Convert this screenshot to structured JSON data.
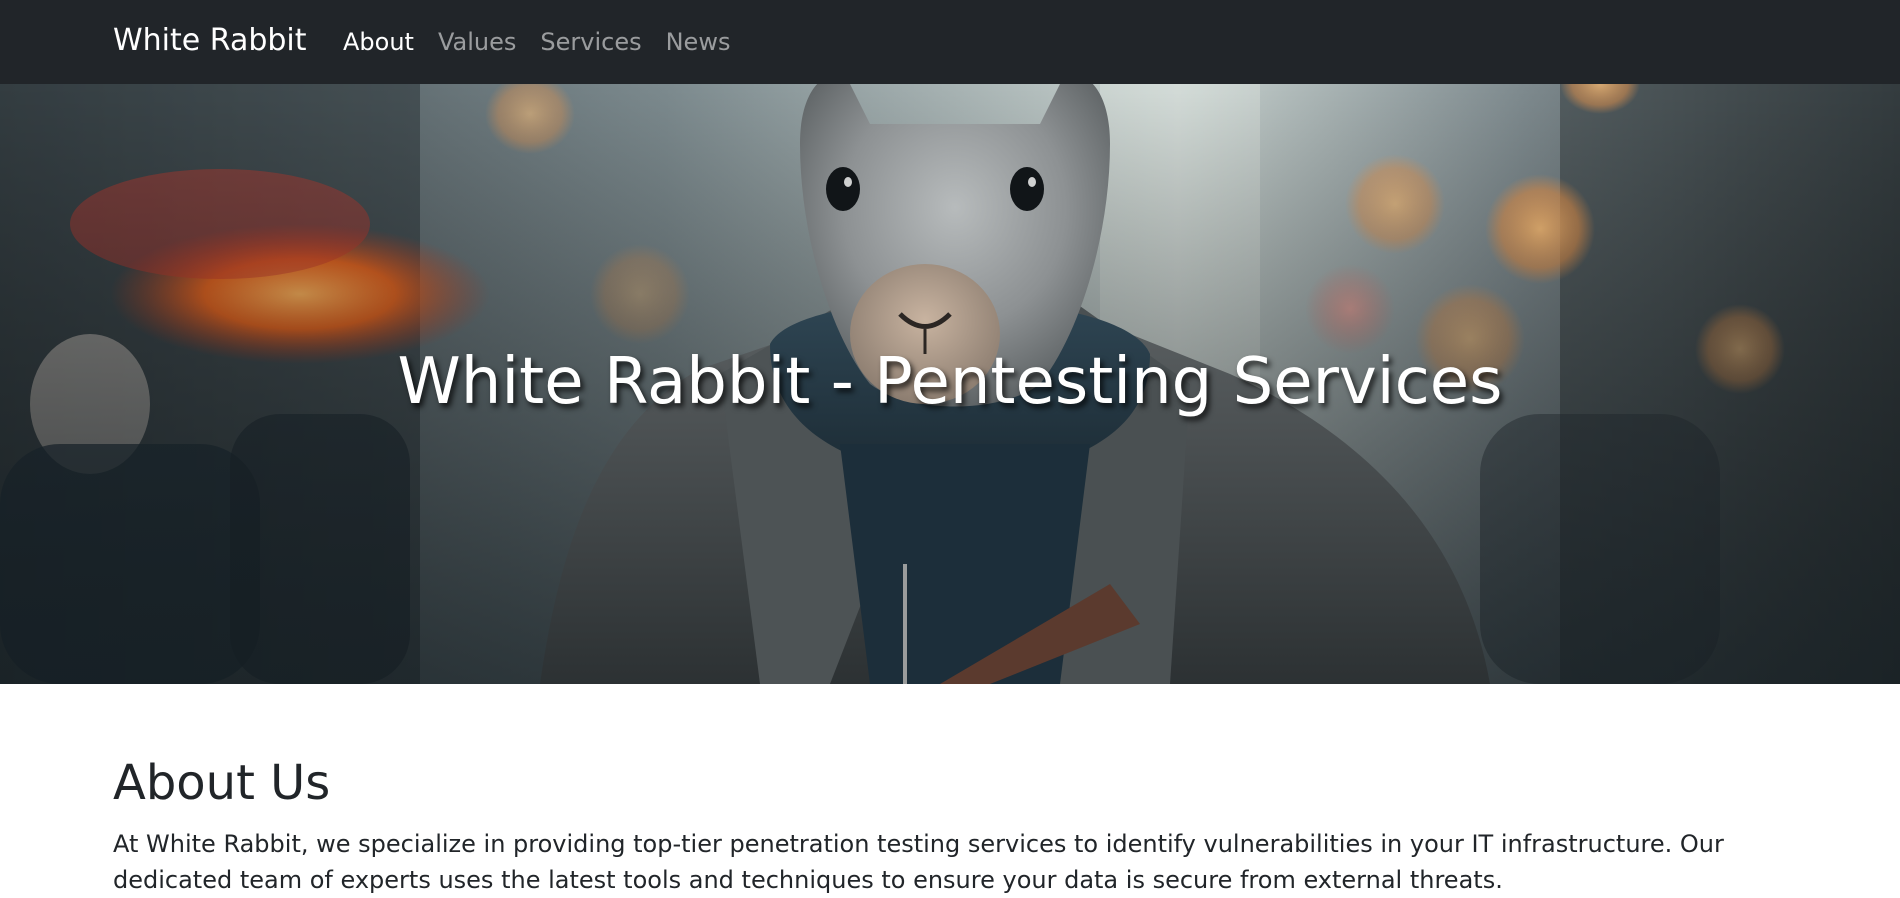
{
  "nav": {
    "brand": "White Rabbit",
    "links": [
      {
        "label": "About",
        "active": true
      },
      {
        "label": "Values",
        "active": false
      },
      {
        "label": "Services",
        "active": false
      },
      {
        "label": "News",
        "active": false
      }
    ]
  },
  "hero": {
    "title": "White Rabbit - Pentesting Services",
    "image": "rabbit-in-leather-jacket-on-city-street"
  },
  "about": {
    "title": "About Us",
    "text": "At White Rabbit, we specialize in providing top-tier penetration testing services to identify vulnerabilities in your IT infrastructure. Our dedicated team of experts uses the latest tools and techniques to ensure your data is secure from external threats."
  },
  "colors": {
    "navbar_bg": "#212529",
    "nav_active": "#ffffff",
    "nav_inactive": "#8f9193",
    "body_text": "#212529"
  }
}
